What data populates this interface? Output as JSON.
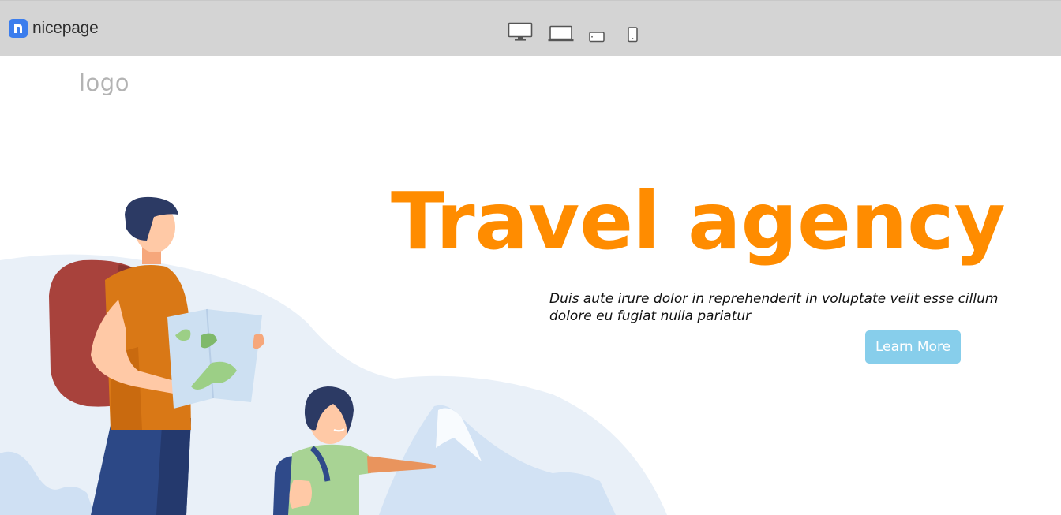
{
  "app": {
    "brand_name": "nicepage",
    "brand_icon": "nicepage-logo-icon",
    "device_buttons": [
      {
        "name": "desktop-view-icon"
      },
      {
        "name": "laptop-view-icon"
      },
      {
        "name": "tablet-landscape-view-icon"
      },
      {
        "name": "phone-view-icon"
      }
    ]
  },
  "page": {
    "logo_text": "logo",
    "headline": "Travel agency",
    "intro": "Duis aute irure dolor in reprehenderit in voluptate velit esse cillum dolore eu fugiat nulla pariatur",
    "cta_label": "Learn More"
  },
  "colors": {
    "topbar": "#d4d4d4",
    "brand_blue": "#3b7ded",
    "headline_orange": "#ff8c00",
    "cta_blue": "#87ceeb",
    "logo_gray": "#b3b3b3",
    "backdrop": "#e9f0f8",
    "mountains": "#cfdff3"
  }
}
